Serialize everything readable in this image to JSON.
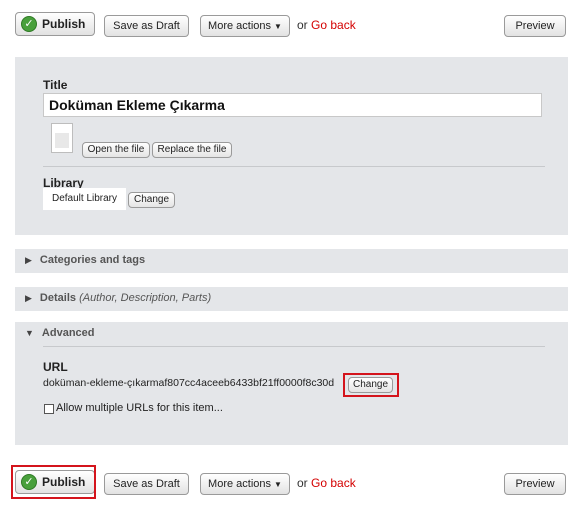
{
  "toolbar": {
    "publish_label": "Publish",
    "save_draft_label": "Save as Draft",
    "more_actions_label": "More actions",
    "or_text": "or",
    "go_back_label": "Go back",
    "preview_label": "Preview"
  },
  "editor": {
    "title_label": "Title",
    "title_value": "Doküman Ekleme Çıkarma",
    "open_file_label": "Open the file",
    "replace_file_label": "Replace the file",
    "library_label": "Library",
    "library_value": "Default Library",
    "library_change_label": "Change"
  },
  "sections": {
    "categories_label": "Categories and tags",
    "details_label": "Details",
    "details_sub": "(Author, Description, Parts)",
    "advanced_label": "Advanced"
  },
  "advanced": {
    "url_label": "URL",
    "url_value": "doküman-ekleme-çıkarmaf807cc4aceeb6433bf21ff0000f8c30d",
    "url_change_label": "Change",
    "allow_multiple_label": "Allow multiple URLs for this item..."
  },
  "colors": {
    "panel_bg": "#e4e6e9",
    "highlight": "#d4141c",
    "go_back": "#d40000",
    "publish_check": "#49a03c"
  }
}
